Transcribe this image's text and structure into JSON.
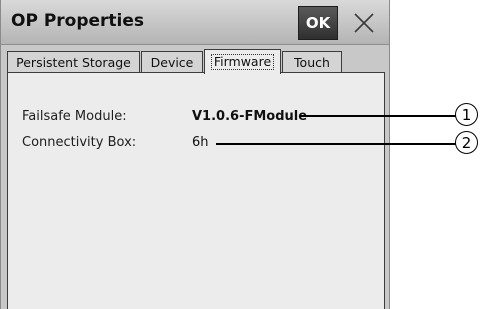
{
  "window": {
    "title": "OP Properties",
    "ok_label": "OK"
  },
  "tabs": [
    {
      "label": "Persistent Storage"
    },
    {
      "label": "Device"
    },
    {
      "label": "Firmware",
      "active": true
    },
    {
      "label": "Touch"
    }
  ],
  "firmware": {
    "failsafe_label": "Failsafe Module:",
    "failsafe_value": "V1.0.6-FModule",
    "connectivity_label": "Connectivity Box:",
    "connectivity_value": "6h"
  },
  "callouts": [
    "1",
    "2"
  ],
  "icons": {
    "close": "close-icon"
  }
}
